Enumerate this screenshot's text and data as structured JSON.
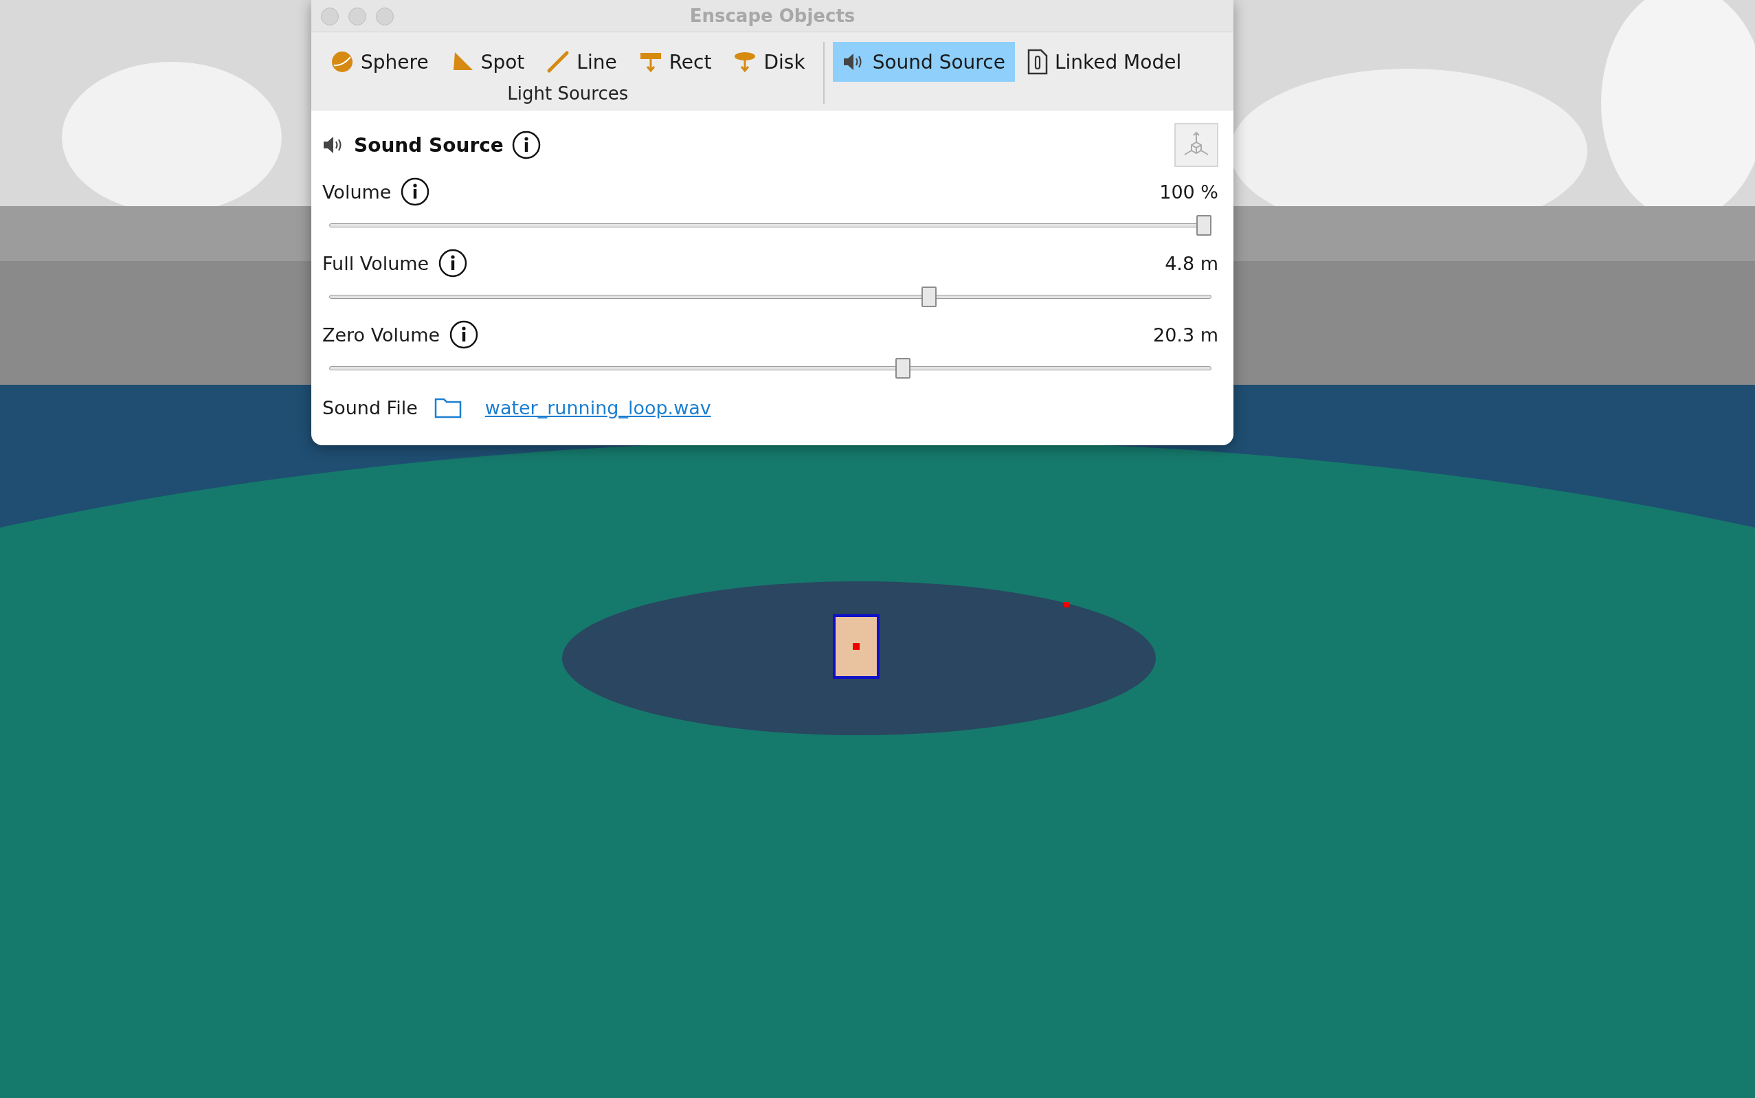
{
  "window": {
    "title": "Enscape Objects"
  },
  "toolbar": {
    "light_sources": {
      "label": "Light Sources",
      "items": [
        {
          "kind": "sphere",
          "label": "Sphere",
          "selected": false
        },
        {
          "kind": "spot",
          "label": "Spot",
          "selected": false
        },
        {
          "kind": "line",
          "label": "Line",
          "selected": false
        },
        {
          "kind": "rect",
          "label": "Rect",
          "selected": false
        },
        {
          "kind": "disk",
          "label": "Disk",
          "selected": false
        }
      ]
    },
    "objects": [
      {
        "kind": "sound",
        "label": "Sound Source",
        "selected": true
      },
      {
        "kind": "model",
        "label": "Linked Model",
        "selected": false
      }
    ]
  },
  "panel": {
    "title": "Sound Source",
    "sliders": [
      {
        "label": "Volume",
        "value": "100 %",
        "level": 1
      },
      {
        "label": "Full Volume",
        "value": "4.8 m",
        "level": 0.683
      },
      {
        "label": "Zero Volume",
        "value": "20.3 m",
        "level": 0.653
      }
    ],
    "sound_file": {
      "label": "Sound File",
      "file": "water_running_loop.wav"
    }
  }
}
